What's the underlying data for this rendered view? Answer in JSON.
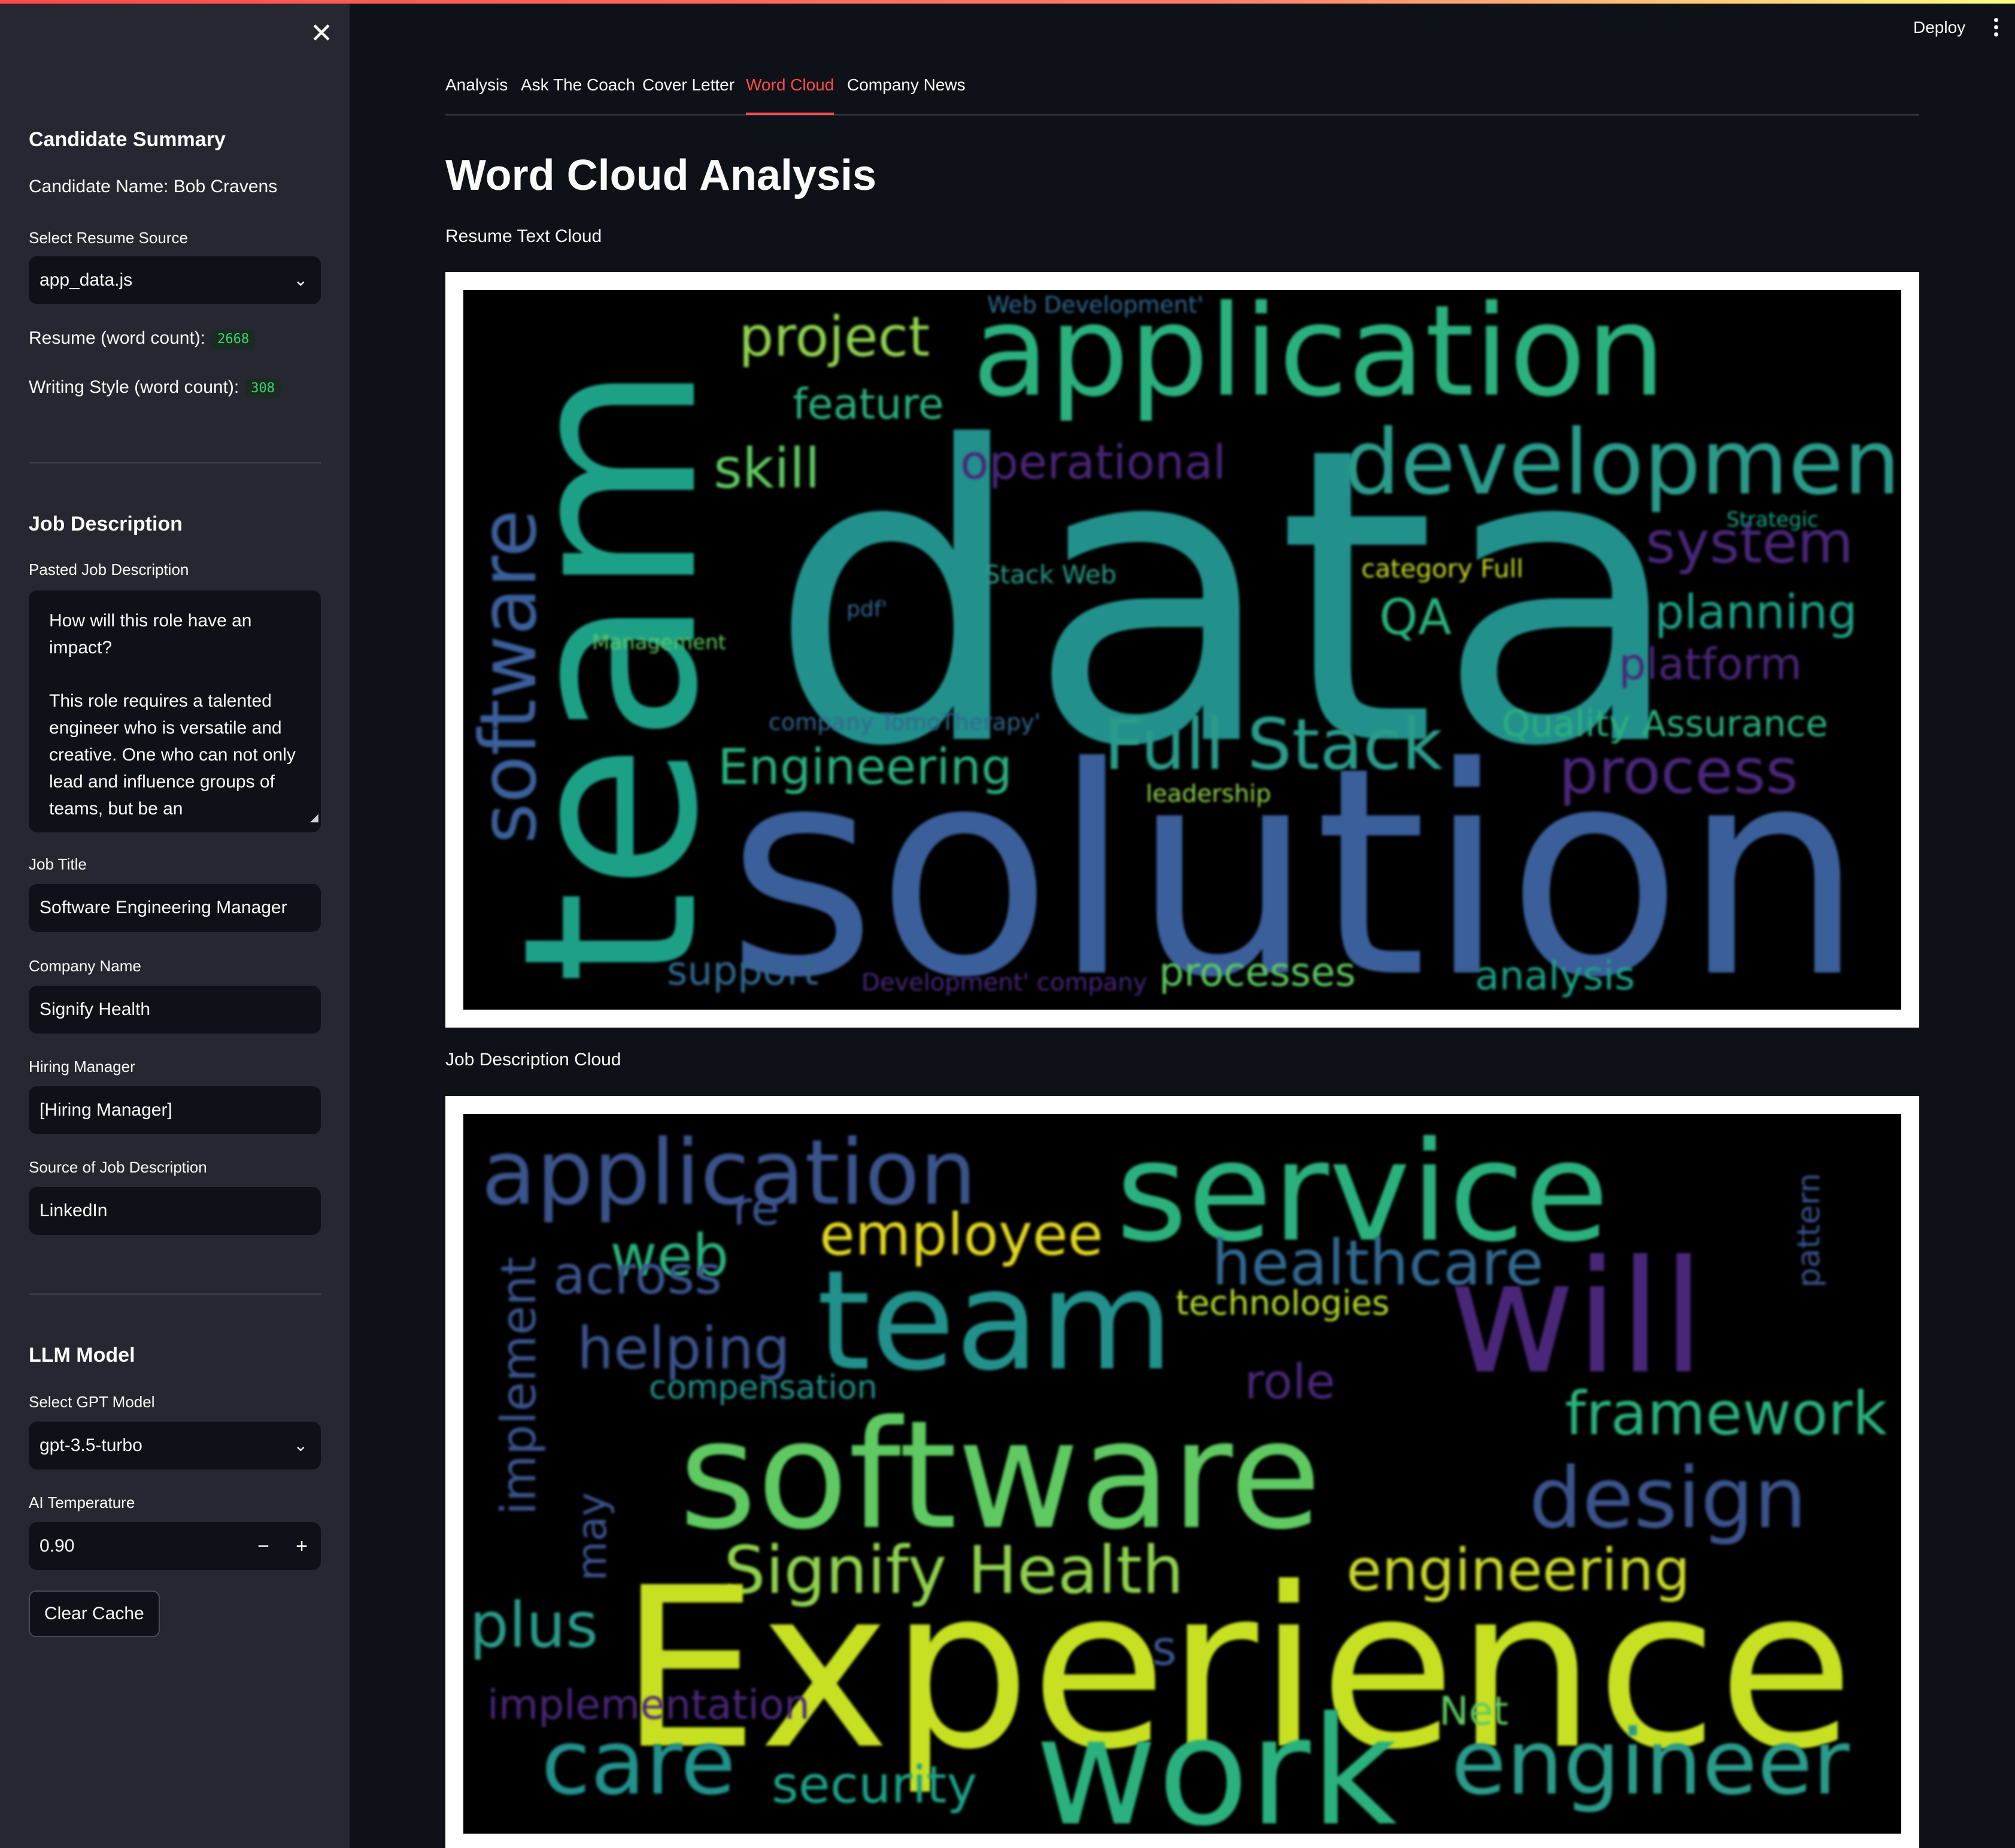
{
  "header": {
    "deploy_label": "Deploy"
  },
  "sidebar": {
    "candidate_summary": {
      "heading": "Candidate Summary",
      "candidate_name": "Candidate Name: Bob Cravens",
      "resume_source_label": "Select Resume Source",
      "resume_source_value": "app_data.js",
      "resume_word_count_label": "Resume (word count):",
      "resume_word_count": "2668",
      "writing_style_label": "Writing Style (word count):",
      "writing_style_count": "308"
    },
    "job_description": {
      "heading": "Job Description",
      "pasted_label": "Pasted Job Description",
      "pasted_text_p1": "How will this role have an impact?",
      "pasted_text_p2": "This role requires a talented engineer who is versatile and creative. One who can not only lead and influence groups of teams, but be an",
      "job_title_label": "Job Title",
      "job_title_value": "Software Engineering Manager",
      "company_label": "Company Name",
      "company_value": "Signify Health",
      "hiring_manager_label": "Hiring Manager",
      "hiring_manager_value": "[Hiring Manager]",
      "source_label": "Source of Job Description",
      "source_value": "LinkedIn"
    },
    "llm": {
      "heading": "LLM Model",
      "model_label": "Select GPT Model",
      "model_value": "gpt-3.5-turbo",
      "temperature_label": "AI Temperature",
      "temperature_value": "0.90",
      "minus": "−",
      "plus": "+",
      "clear_cache_label": "Clear Cache"
    }
  },
  "tabs": [
    {
      "label": "Analysis",
      "active": false
    },
    {
      "label": "Ask The Coach",
      "active": false
    },
    {
      "label": "Cover Letter",
      "active": false
    },
    {
      "label": "Word Cloud",
      "active": true
    },
    {
      "label": "Company News",
      "active": false
    }
  ],
  "main": {
    "title": "Word Cloud Analysis",
    "resume_cloud_caption": "Resume Text Cloud",
    "job_cloud_caption": "Job Description Cloud"
  },
  "resume_cloud_words": [
    "data",
    "solution",
    "team",
    "application",
    "development",
    "software",
    "project",
    "feature",
    "skill",
    "operational",
    "Web Development'",
    "system",
    "planning",
    "platform",
    "Strategic",
    "Stack Web",
    "category Full",
    "QA",
    "pdf'",
    "Management",
    "company TomoTherapy'",
    "Full Stack",
    "Engineering",
    "Quality Assurance",
    "process",
    "leadership",
    "support",
    "Development' company",
    "processes",
    "analysis"
  ],
  "job_cloud_words": [
    "application",
    "service",
    "re",
    "employee",
    "web",
    "across",
    "healthcare",
    "team",
    "will",
    "implement",
    "pattern",
    "helping",
    "technologies",
    "compensation",
    "role",
    "framework",
    "software",
    "design",
    "may",
    "Signify Health",
    "engineering",
    "plus",
    "Experience",
    "s",
    "implementation",
    "Net",
    "care",
    "security",
    "work",
    "engineer"
  ]
}
